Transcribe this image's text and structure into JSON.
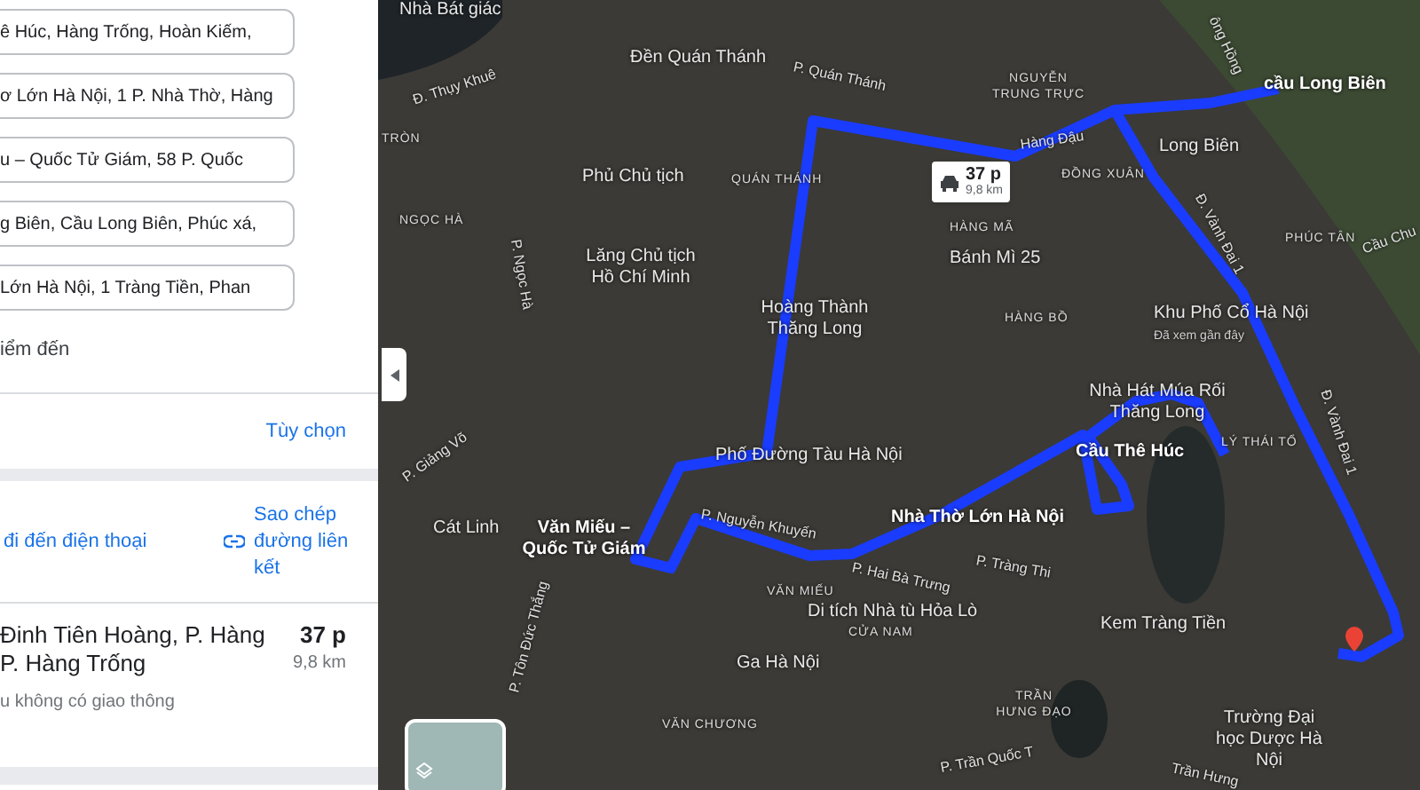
{
  "directions_panel": {
    "waypoints": [
      {
        "value": "ê Húc, Hàng Trống, Hoàn Kiếm,"
      },
      {
        "value": "ơ Lớn Hà Nội, 1 P. Nhà Thờ, Hàng"
      },
      {
        "value": "u – Quốc Tử Giám, 58 P. Quốc"
      },
      {
        "value": "g Biên, Cầu Long Biên, Phúc xá, "
      },
      {
        "value": "Lớn Hà Nội, 1 Tràng Tiền, Phan"
      }
    ],
    "add_destination": "iểm đến",
    "options_link": "Tùy chọn",
    "send_to_phone": "đi đến điện thoại",
    "copy_link": "Sao chép đường liên kết",
    "route": {
      "title_lines": [
        "Đinh Tiên Hoàng, P. Hàng",
        "P. Hàng Trống"
      ],
      "duration": "37 p",
      "distance": "9,8 km",
      "note": "u không có giao thông"
    }
  },
  "map": {
    "route_badge": {
      "duration": "37 p",
      "distance": "9,8 km"
    },
    "labels": [
      {
        "text": "Nhà Bát giác",
        "kind": "place"
      },
      {
        "text": "Đền Quán Thánh",
        "kind": "place"
      },
      {
        "text": "P. Quán Thánh",
        "kind": "street"
      },
      {
        "text": "Đ. Thụy Khuê",
        "kind": "street"
      },
      {
        "text": "TRÒN",
        "kind": "area"
      },
      {
        "text": "Phủ Chủ tịch",
        "kind": "place"
      },
      {
        "text": "QUÁN THÁNH",
        "kind": "area"
      },
      {
        "text": "NGỌC HÀ",
        "kind": "area"
      },
      {
        "text": "P. Ngọc Hà",
        "kind": "street"
      },
      {
        "text": "Lăng Chủ tịch Hồ Chí Minh",
        "kind": "place"
      },
      {
        "text": "Hoàng Thành Thăng Long",
        "kind": "place"
      },
      {
        "text": "ông Hồng",
        "kind": "street"
      },
      {
        "text": "NGUYỄN TRUNG TRỰC",
        "kind": "area"
      },
      {
        "text": "cầu Long Biên",
        "kind": "stop"
      },
      {
        "text": "Hàng Đậu",
        "kind": "street"
      },
      {
        "text": "Long Biên",
        "kind": "place"
      },
      {
        "text": "ĐỒNG XUÂN",
        "kind": "area"
      },
      {
        "text": "Đ. Vành Đai 1",
        "kind": "street"
      },
      {
        "text": "HÀNG MÃ",
        "kind": "area"
      },
      {
        "text": "Bánh Mì 25",
        "kind": "place"
      },
      {
        "text": "PHÚC TÂN",
        "kind": "area"
      },
      {
        "text": "Cầu Chu",
        "kind": "street"
      },
      {
        "text": "HÀNG BỒ",
        "kind": "area"
      },
      {
        "text": "Khu Phố Cổ Hà Nội",
        "kind": "place"
      },
      {
        "text": "Đã xem gần đây",
        "kind": "note"
      },
      {
        "text": "Phố Đường Tàu Hà Nội",
        "kind": "place"
      },
      {
        "text": "Nhà Hát Múa Rối Thăng Long",
        "kind": "place"
      },
      {
        "text": "Cầu Thê Húc",
        "kind": "stop"
      },
      {
        "text": "LÝ THÁI TỔ",
        "kind": "area"
      },
      {
        "text": "Đ. Vành Đai 1",
        "kind": "street"
      },
      {
        "text": "P. Giảng Võ",
        "kind": "street"
      },
      {
        "text": "Cát Linh",
        "kind": "place"
      },
      {
        "text": "Văn Miếu – Quốc Tử Giám",
        "kind": "stop"
      },
      {
        "text": "P. Nguyễn Khuyến",
        "kind": "street"
      },
      {
        "text": "Nhà Thờ Lớn Hà Nội",
        "kind": "stop"
      },
      {
        "text": "P. Hai Bà Trưng",
        "kind": "street"
      },
      {
        "text": "P. Tràng Thi",
        "kind": "street"
      },
      {
        "text": "VĂN MIẾU",
        "kind": "area"
      },
      {
        "text": "Di tích Nhà tù Hỏa Lò",
        "kind": "place"
      },
      {
        "text": "CỬA NAM",
        "kind": "area"
      },
      {
        "text": "Kem Tràng Tiền",
        "kind": "place"
      },
      {
        "text": "Ga Hà Nội",
        "kind": "place"
      },
      {
        "text": "P. Tôn Đức Thắng",
        "kind": "street"
      },
      {
        "text": "VĂN CHƯƠNG",
        "kind": "area"
      },
      {
        "text": "TRẦN HƯNG ĐẠO",
        "kind": "area"
      },
      {
        "text": "Trường Đại học Dược Hà Nội",
        "kind": "place"
      },
      {
        "text": "P. Trần Quốc T",
        "kind": "street"
      },
      {
        "text": "Trần Hưng",
        "kind": "street"
      }
    ]
  }
}
